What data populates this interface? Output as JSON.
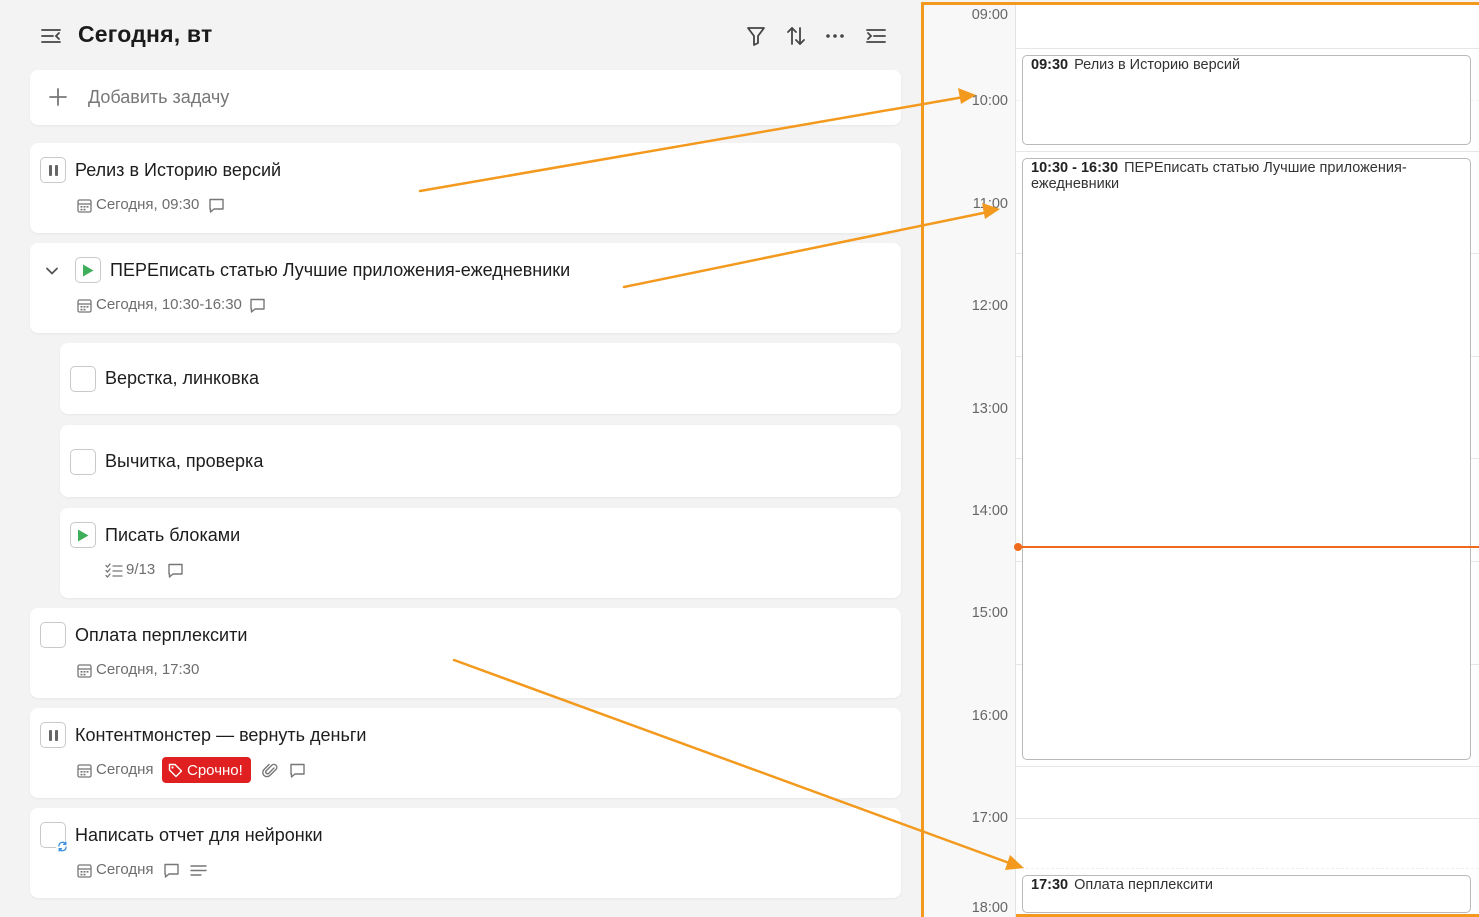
{
  "header": {
    "title": "Сегодня, вт"
  },
  "add_task": {
    "placeholder": "Добавить задачу"
  },
  "tasks": [
    {
      "title": "Релиз в Историю версий",
      "date": "Сегодня, 09:30",
      "state": "paused"
    },
    {
      "title": "ПЕРЕписать статью Лучшие приложения-ежедневники",
      "date": "Сегодня, 10:30-16:30",
      "state": "running",
      "expanded": true,
      "subtasks": [
        {
          "title": "Верстка, линковка",
          "state": "todo"
        },
        {
          "title": "Вычитка, проверка",
          "state": "todo"
        },
        {
          "title": "Писать блоками",
          "state": "running",
          "progress": "9/13"
        }
      ]
    },
    {
      "title": "Оплата перплексити",
      "date": "Сегодня, 17:30",
      "state": "todo"
    },
    {
      "title": "Контентмонстер — вернуть деньги",
      "date": "Сегодня",
      "state": "paused",
      "tag": "Срочно!"
    },
    {
      "title": "Написать отчет для нейронки",
      "date": "Сегодня",
      "state": "todo",
      "recurring": true
    }
  ],
  "calendar": {
    "hours": [
      "09:00",
      "10:00",
      "11:00",
      "12:00",
      "13:00",
      "14:00",
      "15:00",
      "16:00",
      "17:00",
      "18:00"
    ],
    "events": [
      {
        "time": "09:30",
        "title": "Релиз в Историю версий"
      },
      {
        "time": "10:30 - 16:30",
        "title": "ПЕРЕписать статью Лучшие приложения-ежедневники"
      },
      {
        "time": "17:30",
        "title": "Оплата перплексити"
      }
    ]
  },
  "colors": {
    "accent_arrow": "#f39a1e",
    "now_line": "#f06a1e",
    "urgent_tag": "#e02020",
    "play_green": "#3fae5a"
  },
  "icons": [
    "menu-collapse-icon",
    "filter-icon",
    "sort-icon",
    "more-icon",
    "panel-toggle-icon",
    "plus-icon",
    "calendar-icon",
    "comment-icon",
    "checklist-icon",
    "attachment-icon",
    "description-icon",
    "tag-icon",
    "repeat-icon",
    "chevron-down-icon",
    "pause-icon",
    "play-icon"
  ]
}
